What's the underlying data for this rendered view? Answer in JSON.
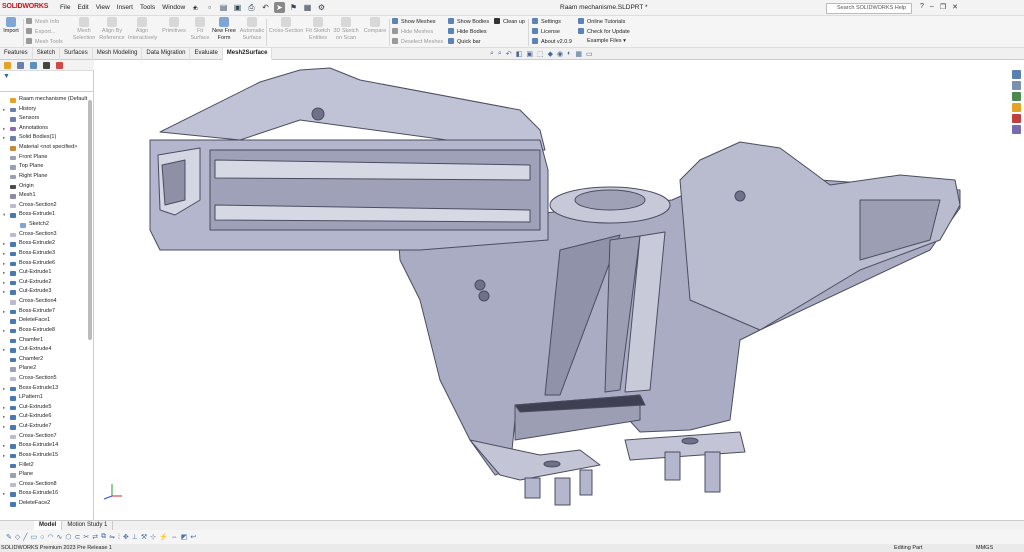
{
  "app": {
    "logo": "SOLIDWORKS",
    "document_title": "Raam mechanisme.SLDPRT *"
  },
  "menu": [
    "File",
    "Edit",
    "View",
    "Insert",
    "Tools",
    "Window"
  ],
  "search": {
    "placeholder": "Search SOLIDWORKS Help"
  },
  "ribbon": {
    "import": "Import",
    "mesh_info": "Mesh Info",
    "export": "Export...",
    "mesh_tools": "Mesh Tools",
    "mesh_selection": [
      "Mesh",
      "Selection"
    ],
    "align_by_reference": [
      "Align By",
      "Reference"
    ],
    "align_interactively": [
      "Align",
      "Interactively"
    ],
    "primitives": "Primitives",
    "fit_surface": [
      "Fit",
      "Surface"
    ],
    "new_free_form": [
      "New Free",
      "Form"
    ],
    "automatic_surface": [
      "Automatic",
      "Surface"
    ],
    "cross_section": "Cross-Section",
    "fit_sketch_entities": [
      "Fit Sketch",
      "Entities"
    ],
    "sketch_on_scan": [
      "3D Sketch",
      "on Scan"
    ],
    "compare": "Compare",
    "show_meshes": "Show Meshes",
    "hide_meshes": "Hide Meshes",
    "deselect_meshes": "Deselect Meshes",
    "show_bodies": "Show Bodies",
    "hide_bodies": "Hide Bodies",
    "quick_bar": "Quick bar",
    "clean_up": "Clean up",
    "settings": "Settings",
    "license": "License",
    "about": "About v2.0.9",
    "online_tutorials": "Online Tutorials",
    "check_update": "Check for Update",
    "example_files": "Example Files"
  },
  "tabs": [
    "Features",
    "Sketch",
    "Surfaces",
    "Mesh Modeling",
    "Data Migration",
    "Evaluate",
    "Mesh2Surface"
  ],
  "active_tab": "Mesh2Surface",
  "tree": [
    {
      "label": "Raam mechanisme (Default",
      "icon": "part",
      "exp": ""
    },
    {
      "label": "History",
      "icon": "folder",
      "exp": "▸"
    },
    {
      "label": "Sensors",
      "icon": "sensor",
      "exp": ""
    },
    {
      "label": "Annotations",
      "icon": "annot",
      "exp": "▸"
    },
    {
      "label": "Solid Bodies(1)",
      "icon": "folder",
      "exp": "▸"
    },
    {
      "label": "Material <not specified>",
      "icon": "material",
      "exp": ""
    },
    {
      "label": "Front Plane",
      "icon": "plane",
      "exp": ""
    },
    {
      "label": "Top Plane",
      "icon": "plane",
      "exp": ""
    },
    {
      "label": "Right Plane",
      "icon": "plane",
      "exp": ""
    },
    {
      "label": "Origin",
      "icon": "origin",
      "exp": ""
    },
    {
      "label": "Mesh1",
      "icon": "mesh",
      "exp": ""
    },
    {
      "label": "Cross-Section2",
      "icon": "cross",
      "exp": ""
    },
    {
      "label": "Boss-Extrude1",
      "icon": "feature",
      "exp": "▾"
    },
    {
      "label": "Sketch2",
      "icon": "sketch",
      "exp": "",
      "indent": 1
    },
    {
      "label": "Cross-Section3",
      "icon": "cross",
      "exp": ""
    },
    {
      "label": "Boss-Extrude2",
      "icon": "feature",
      "exp": "▸"
    },
    {
      "label": "Boss-Extrude3",
      "icon": "feature",
      "exp": "▸"
    },
    {
      "label": "Boss-Extrude6",
      "icon": "feature",
      "exp": "▸"
    },
    {
      "label": "Cut-Extrude1",
      "icon": "feature",
      "exp": "▸"
    },
    {
      "label": "Cut-Extrude2",
      "icon": "feature",
      "exp": "▸"
    },
    {
      "label": "Cut-Extrude3",
      "icon": "feature",
      "exp": "▸"
    },
    {
      "label": "Cross-Section4",
      "icon": "cross",
      "exp": ""
    },
    {
      "label": "Boss-Extrude7",
      "icon": "feature",
      "exp": "▸"
    },
    {
      "label": "DeleteFace1",
      "icon": "feature",
      "exp": ""
    },
    {
      "label": "Boss-Extrude8",
      "icon": "feature",
      "exp": "▸"
    },
    {
      "label": "Chamfer1",
      "icon": "feature",
      "exp": ""
    },
    {
      "label": "Cut-Extrude4",
      "icon": "feature",
      "exp": "▸"
    },
    {
      "label": "Chamfer2",
      "icon": "feature",
      "exp": ""
    },
    {
      "label": "Plane2",
      "icon": "plane",
      "exp": ""
    },
    {
      "label": "Cross-Section5",
      "icon": "cross",
      "exp": ""
    },
    {
      "label": "Boss-Extrude13",
      "icon": "feature",
      "exp": "▸"
    },
    {
      "label": "LPattern1",
      "icon": "feature",
      "exp": ""
    },
    {
      "label": "Cut-Extrude5",
      "icon": "feature",
      "exp": "▸"
    },
    {
      "label": "Cut-Extrude6",
      "icon": "feature",
      "exp": "▸"
    },
    {
      "label": "Cut-Extrude7",
      "icon": "feature",
      "exp": "▸"
    },
    {
      "label": "Cross-Section7",
      "icon": "cross",
      "exp": ""
    },
    {
      "label": "Boss-Extrude14",
      "icon": "feature",
      "exp": "▸"
    },
    {
      "label": "Boss-Extrude15",
      "icon": "feature",
      "exp": "▸"
    },
    {
      "label": "Fillet2",
      "icon": "feature",
      "exp": ""
    },
    {
      "label": "Plane",
      "icon": "plane",
      "exp": ""
    },
    {
      "label": "Cross-Section8",
      "icon": "cross",
      "exp": ""
    },
    {
      "label": "Boss-Extrude16",
      "icon": "feature",
      "exp": "▸"
    },
    {
      "label": "DeleteFace2",
      "icon": "feature",
      "exp": ""
    }
  ],
  "bottom_tabs": [
    "Model",
    "Motion Study 1"
  ],
  "status": {
    "left": "SOLIDWORKS Premium 2023 Pre Release 1",
    "editing": "Editing Part",
    "units": "MMGS"
  },
  "colors": {
    "model_face": "#b3b6cc",
    "model_edge": "#4b4d60",
    "accent": "#d0101a"
  }
}
